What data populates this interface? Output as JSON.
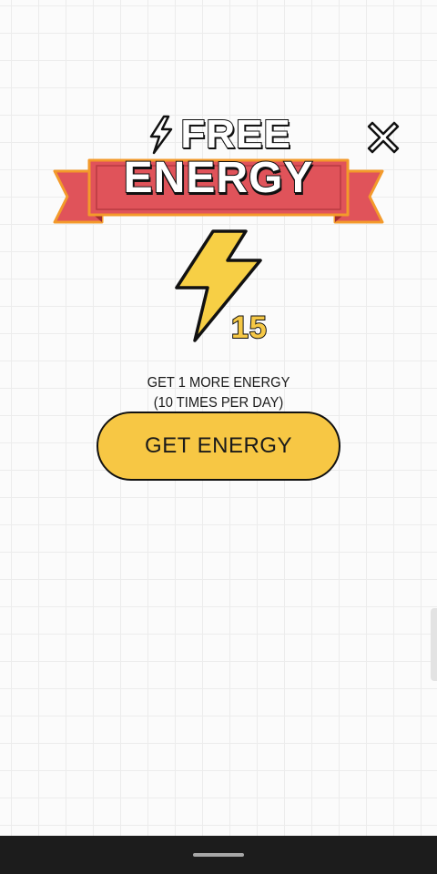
{
  "title": {
    "line1": "FREE",
    "line2": "ENERGY"
  },
  "energy": {
    "count": "15"
  },
  "info": {
    "line1": "GET 1 MORE ENERGY",
    "line2": "(10 TIMES PER DAY)"
  },
  "button": {
    "label": "GET ENERGY"
  },
  "icons": {
    "title_bolt": "lightning-bolt-icon",
    "close": "close-icon",
    "energy": "lightning-bolt-icon"
  },
  "colors": {
    "ribbon_red": "#e0535a",
    "ribbon_border": "#f39a2b",
    "bolt_yellow": "#f7cf45",
    "button_yellow": "#f7c744",
    "nav_bar": "#1c1c1c"
  }
}
